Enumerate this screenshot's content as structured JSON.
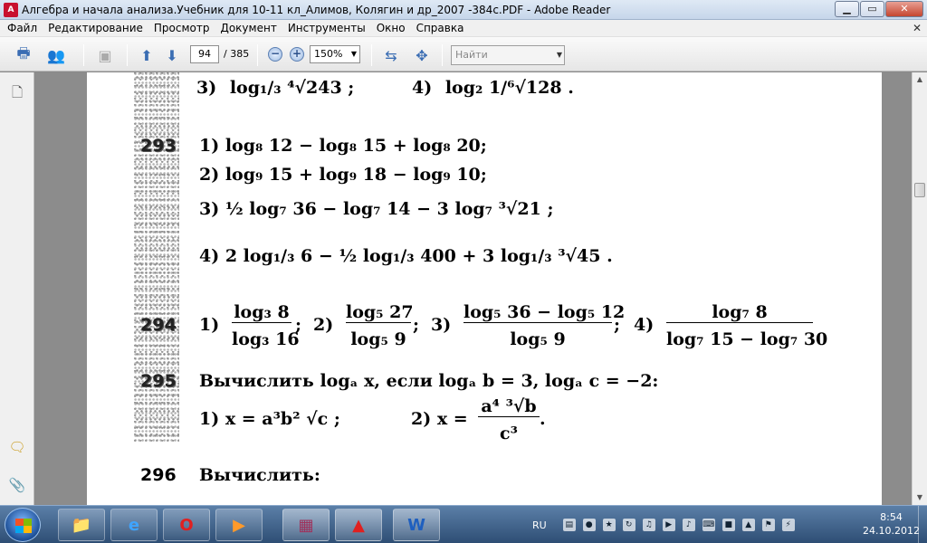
{
  "window": {
    "title": "Алгебра и начала анализа.Учебник для 10-11 кл_Алимов, Колягин и др_2007 -384с.PDF - Adobe Reader",
    "app_icon": "acrobat-icon",
    "buttons": {
      "minimize": "▁",
      "maximize": "▭",
      "close": "✕"
    }
  },
  "menu": {
    "items": [
      "Файл",
      "Редактирование",
      "Просмотр",
      "Документ",
      "Инструменты",
      "Окно",
      "Справка"
    ],
    "close": "✕"
  },
  "toolbar": {
    "current_page": "94",
    "page_separator": "/",
    "total_pages": "385",
    "zoom": "150%",
    "zoom_out": "−",
    "zoom_in": "+",
    "find_placeholder": "Найти",
    "icons": [
      "print-icon",
      "collaborate-icon",
      "share-icon",
      "page-up-icon",
      "page-down-icon",
      "zoom-out-icon",
      "zoom-in-icon",
      "fit-width-icon",
      "fit-page-icon"
    ]
  },
  "left_panel": {
    "icons": [
      "pages-icon",
      "comments-icon",
      "attachments-icon"
    ]
  },
  "document": {
    "line_a": {
      "num": "3)",
      "expr": "log₁/₃ ⁴√243 ;"
    },
    "line_b": {
      "num": "4)",
      "expr": "log₂ 1/⁶√128 ."
    },
    "p293": {
      "number": "293",
      "items": [
        "1)  log₈ 12 − log₈ 15 + log₈ 20;",
        "2)  log₉ 15 + log₉ 18 − log₉ 10;",
        "3)  ½ log₇ 36 − log₇ 14 − 3 log₇ ³√21 ;",
        "4)  2 log₁/₃ 6 − ½ log₁/₃ 400 + 3 log₁/₃ ³√45 ."
      ]
    },
    "p294": {
      "number": "294",
      "items": [
        {
          "n": "1)",
          "num": "log₃ 8",
          "den": "log₃ 16",
          "sep": ";"
        },
        {
          "n": "2)",
          "num": "log₅ 27",
          "den": "log₅ 9",
          "sep": ";"
        },
        {
          "n": "3)",
          "num": "log₅ 36 − log₅ 12",
          "den": "log₅ 9",
          "sep": ";"
        },
        {
          "n": "4)",
          "num": "log₇ 8",
          "den": "log₇ 15 − log₇ 30",
          "sep": ""
        }
      ]
    },
    "p295": {
      "number": "295",
      "text": "Вычислить  logₐ x,  если  logₐ b = 3,  logₐ c = −2:",
      "item1": "1)  x = a³b² √c ;",
      "item2_label": "2)  x =",
      "item2_num": "a⁴ ³√b",
      "item2_den": "c³",
      "item2_end": "."
    },
    "p296": {
      "number": "296",
      "text": "Вычислить:"
    }
  },
  "taskbar": {
    "apps": [
      "explorer-icon",
      "ie-icon",
      "opera-icon",
      "media-player-icon",
      "winrar-icon",
      "adobe-reader-icon",
      "word-icon"
    ],
    "language": "RU",
    "time": "8:54",
    "date": "24.10.2012"
  }
}
